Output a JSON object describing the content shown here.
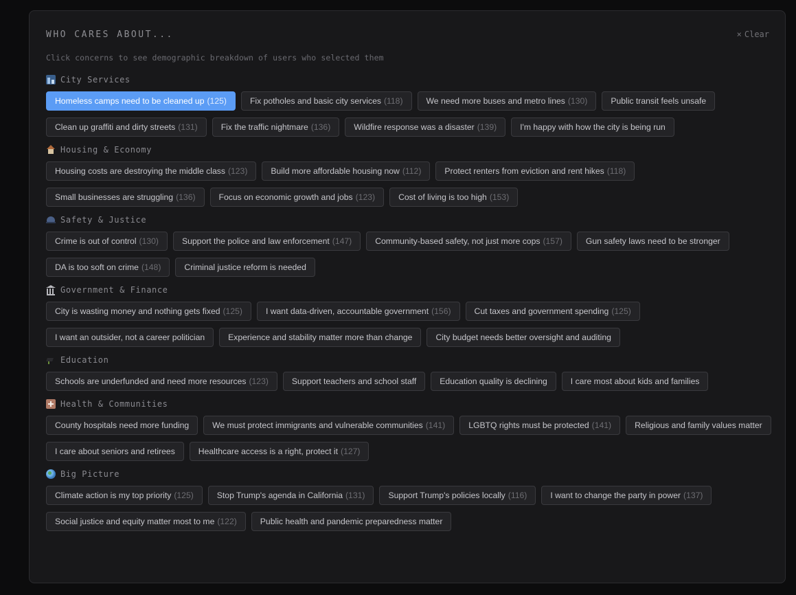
{
  "header": {
    "title": "WHO CARES ABOUT...",
    "clear_icon": "×",
    "clear_label": "Clear",
    "subtitle": "Click concerns to see demographic breakdown of users who selected them"
  },
  "colors": {
    "accent": "#5b9cf5",
    "chip_bg": "#232326",
    "panel_bg": "#18181a"
  },
  "categories": [
    {
      "name": "City Services",
      "icon": "city-icon",
      "chips": [
        {
          "label": "Homeless camps need to be cleaned up",
          "count": "(125)",
          "selected": true
        },
        {
          "label": "Fix potholes and basic city services",
          "count": "(118)"
        },
        {
          "label": "We need more buses and metro lines",
          "count": "(130)"
        },
        {
          "label": "Public transit feels unsafe",
          "count": ""
        },
        {
          "label": "Clean up graffiti and dirty streets",
          "count": "(131)"
        },
        {
          "label": "Fix the traffic nightmare",
          "count": "(136)"
        },
        {
          "label": "Wildfire response was a disaster",
          "count": "(139)"
        },
        {
          "label": "I'm happy with how the city is being run",
          "count": ""
        }
      ]
    },
    {
      "name": "Housing & Economy",
      "icon": "house-icon",
      "chips": [
        {
          "label": "Housing costs are destroying the middle class",
          "count": "(123)"
        },
        {
          "label": "Build more affordable housing now",
          "count": "(112)"
        },
        {
          "label": "Protect renters from eviction and rent hikes",
          "count": "(118)"
        },
        {
          "label": "Small businesses are struggling",
          "count": "(136)"
        },
        {
          "label": "Focus on economic growth and jobs",
          "count": "(123)"
        },
        {
          "label": "Cost of living is too high",
          "count": "(153)"
        }
      ]
    },
    {
      "name": "Safety & Justice",
      "icon": "police-hat-icon",
      "chips": [
        {
          "label": "Crime is out of control",
          "count": "(130)"
        },
        {
          "label": "Support the police and law enforcement",
          "count": "(147)"
        },
        {
          "label": "Community-based safety, not just more cops",
          "count": "(157)"
        },
        {
          "label": "Gun safety laws need to be stronger",
          "count": ""
        },
        {
          "label": "DA is too soft on crime",
          "count": "(148)"
        },
        {
          "label": "Criminal justice reform is needed",
          "count": ""
        }
      ]
    },
    {
      "name": "Government & Finance",
      "icon": "government-building-icon",
      "chips": [
        {
          "label": "City is wasting money and nothing gets fixed",
          "count": "(125)"
        },
        {
          "label": "I want data-driven, accountable government",
          "count": "(156)"
        },
        {
          "label": "Cut taxes and government spending",
          "count": "(125)"
        },
        {
          "label": "I want an outsider, not a career politician",
          "count": ""
        },
        {
          "label": "Experience and stability matter more than change",
          "count": ""
        },
        {
          "label": "City budget needs better oversight and auditing",
          "count": ""
        }
      ]
    },
    {
      "name": "Education",
      "icon": "graduation-cap-icon",
      "chips": [
        {
          "label": "Schools are underfunded and need more resources",
          "count": "(123)"
        },
        {
          "label": "Support teachers and school staff",
          "count": ""
        },
        {
          "label": "Education quality is declining",
          "count": ""
        },
        {
          "label": "I care most about kids and families",
          "count": ""
        }
      ]
    },
    {
      "name": "Health & Communities",
      "icon": "hospital-icon",
      "chips": [
        {
          "label": "County hospitals need more funding",
          "count": ""
        },
        {
          "label": "We must protect immigrants and vulnerable communities",
          "count": "(141)"
        },
        {
          "label": "LGBTQ rights must be protected",
          "count": "(141)"
        },
        {
          "label": "Religious and family values matter",
          "count": ""
        },
        {
          "label": "I care about seniors and retirees",
          "count": ""
        },
        {
          "label": "Healthcare access is a right, protect it",
          "count": "(127)"
        }
      ]
    },
    {
      "name": "Big Picture",
      "icon": "globe-icon",
      "chips": [
        {
          "label": "Climate action is my top priority",
          "count": "(125)"
        },
        {
          "label": "Stop Trump's agenda in California",
          "count": "(131)"
        },
        {
          "label": "Support Trump's policies locally",
          "count": "(116)"
        },
        {
          "label": "I want to change the party in power",
          "count": "(137)"
        },
        {
          "label": "Social justice and equity matter most to me",
          "count": "(122)"
        },
        {
          "label": "Public health and pandemic preparedness matter",
          "count": ""
        }
      ]
    }
  ]
}
